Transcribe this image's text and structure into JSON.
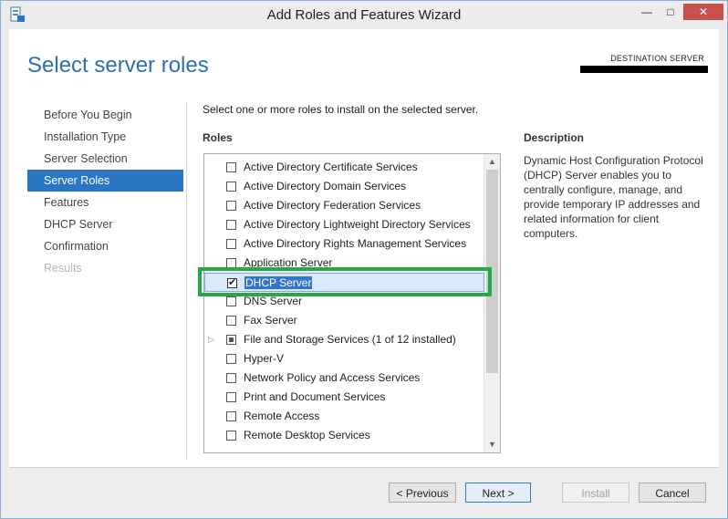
{
  "window": {
    "title": "Add Roles and Features Wizard",
    "controls": {
      "minimize": "—",
      "maximize": "□",
      "close": "✕"
    }
  },
  "header": {
    "page_title": "Select server roles",
    "destination_label": "DESTINATION SERVER",
    "destination_value": "[redacted]"
  },
  "nav": {
    "items": [
      {
        "label": "Before You Begin",
        "state": "normal"
      },
      {
        "label": "Installation Type",
        "state": "normal"
      },
      {
        "label": "Server Selection",
        "state": "normal"
      },
      {
        "label": "Server Roles",
        "state": "active"
      },
      {
        "label": "Features",
        "state": "normal"
      },
      {
        "label": "DHCP Server",
        "state": "normal"
      },
      {
        "label": "Confirmation",
        "state": "normal"
      },
      {
        "label": "Results",
        "state": "disabled"
      }
    ]
  },
  "main": {
    "instruction": "Select one or more roles to install on the selected server.",
    "roles_heading": "Roles",
    "roles": [
      {
        "label": "Active Directory Certificate Services",
        "checked": false
      },
      {
        "label": "Active Directory Domain Services",
        "checked": false
      },
      {
        "label": "Active Directory Federation Services",
        "checked": false
      },
      {
        "label": "Active Directory Lightweight Directory Services",
        "checked": false
      },
      {
        "label": "Active Directory Rights Management Services",
        "checked": false
      },
      {
        "label": "Application Server",
        "checked": false
      },
      {
        "label": "DHCP Server",
        "checked": true,
        "selected": true
      },
      {
        "label": "DNS Server",
        "checked": false
      },
      {
        "label": "Fax Server",
        "checked": false
      },
      {
        "label": "File and Storage Services (1 of 12 installed)",
        "checked": "partial",
        "expandable": true
      },
      {
        "label": "Hyper-V",
        "checked": false
      },
      {
        "label": "Network Policy and Access Services",
        "checked": false
      },
      {
        "label": "Print and Document Services",
        "checked": false
      },
      {
        "label": "Remote Access",
        "checked": false
      },
      {
        "label": "Remote Desktop Services",
        "checked": false
      }
    ],
    "description_heading": "Description",
    "description_text": "Dynamic Host Configuration Protocol (DHCP) Server enables you to centrally configure, manage, and provide temporary IP addresses and related information for client computers."
  },
  "footer": {
    "previous": "< Previous",
    "next": "Next >",
    "install": "Install",
    "cancel": "Cancel"
  },
  "colors": {
    "accent": "#2a76c3",
    "title_blue": "#2c6fb0",
    "highlight_green": "#22aa44",
    "close_red": "#c75050"
  }
}
